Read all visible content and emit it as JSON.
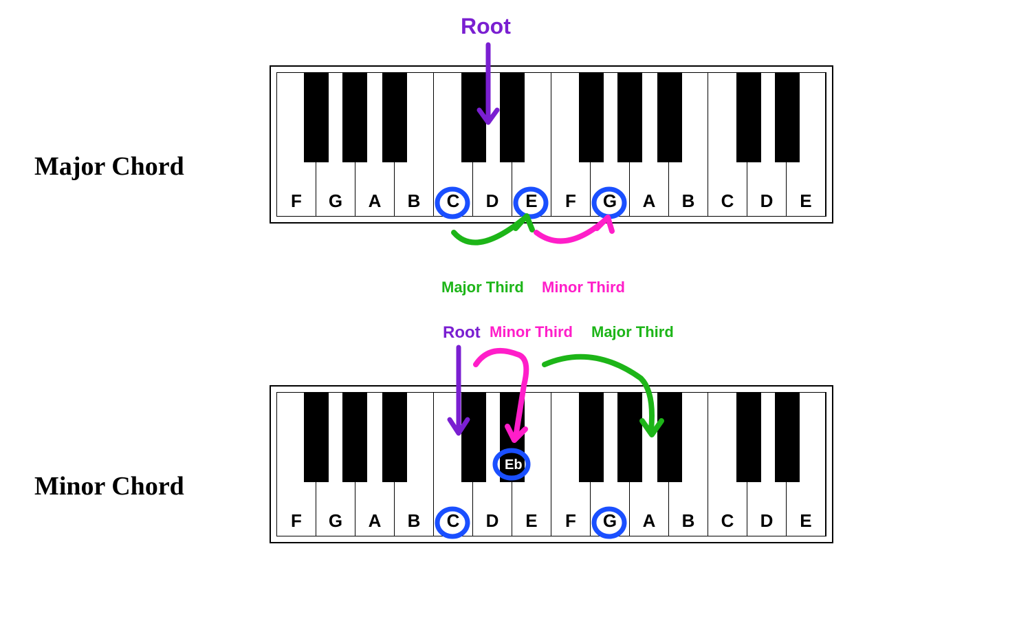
{
  "keys": [
    "F",
    "G",
    "A",
    "B",
    "C",
    "D",
    "E",
    "F",
    "G",
    "A",
    "B",
    "C",
    "D",
    "E"
  ],
  "majorChord": {
    "title": "Major Chord",
    "rootLabel": "Root",
    "interval1": "Major Third",
    "interval2": "Minor Third",
    "circledNotes": [
      "C",
      "E",
      "G"
    ]
  },
  "minorChord": {
    "title": "Minor Chord",
    "rootLabel": "Root",
    "interval1": "Minor Third",
    "interval2": "Major Third",
    "blackKeyLabel": "Eb",
    "circledNotes": [
      "C",
      "Eb",
      "G"
    ]
  },
  "colors": {
    "root": "#7a1fd1",
    "majorThird": "#1db518",
    "minorThird": "#ff1ec9",
    "circle": "#1a4fff"
  }
}
